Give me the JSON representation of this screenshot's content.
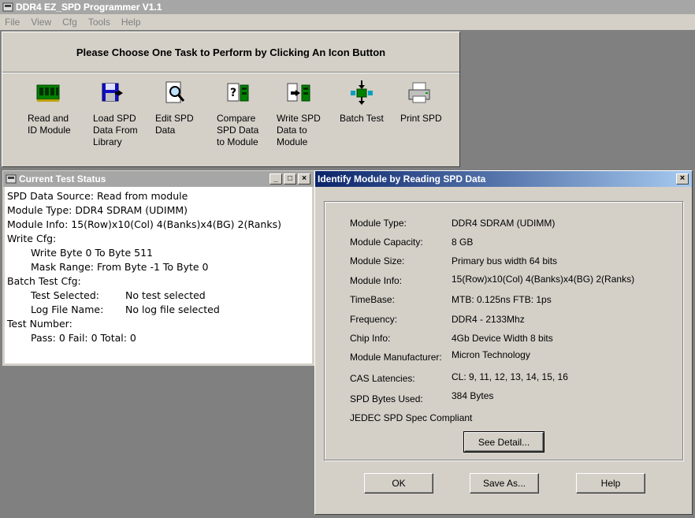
{
  "app": {
    "title": "DDR4 EZ_SPD Programmer V1.1"
  },
  "menu": [
    "File",
    "View",
    "Cfg",
    "Tools",
    "Help"
  ],
  "task_panel": {
    "heading": "Please Choose One Task to Perform by Clicking An Icon Button",
    "tasks": [
      {
        "icon": "memory-module-icon",
        "lines": [
          "Read and",
          "ID Module"
        ]
      },
      {
        "icon": "floppy-load-icon",
        "lines": [
          "Load SPD",
          "Data From",
          "Library"
        ]
      },
      {
        "icon": "magnifier-document-icon",
        "lines": [
          "Edit SPD",
          "Data"
        ]
      },
      {
        "icon": "compare-icon",
        "lines": [
          "Compare",
          "SPD Data",
          "to Module"
        ]
      },
      {
        "icon": "write-module-icon",
        "lines": [
          "Write SPD",
          "Data to",
          "Module"
        ]
      },
      {
        "icon": "batch-test-icon",
        "lines": [
          "Batch Test"
        ]
      },
      {
        "icon": "printer-icon",
        "lines": [
          "Print SPD"
        ]
      }
    ]
  },
  "status_window": {
    "title": "Current Test Status",
    "lines": {
      "source": "SPD Data Source:  Read from module",
      "type": "Module Type: DDR4 SDRAM (UDIMM)",
      "info": "Module Info:  15(Row)x10(Col) 4(Banks)x4(BG) 2(Ranks)",
      "write_cfg": "Write Cfg:",
      "write_bytes": "Write Byte 0 To Byte 511",
      "mask_range": "Mask Range: From Byte -1 To Byte 0",
      "batch_cfg": "Batch Test Cfg:",
      "test_selected_label": "Test Selected:",
      "test_selected_value": "No test selected",
      "log_label": "Log File Name:",
      "log_value": "No log file selected",
      "test_number": "Test Number:",
      "counts": "Pass: 0 Fail: 0 Total: 0"
    },
    "buttons": {
      "minimize": "_",
      "maximize": "□",
      "close": "×"
    }
  },
  "dialog": {
    "title": "Identify Module by Reading SPD Data",
    "close": "×",
    "rows": [
      {
        "label": "Module Type:",
        "value": "DDR4 SDRAM (UDIMM)"
      },
      {
        "label": "Module Capacity:",
        "value": "8 GB"
      },
      {
        "label": "Module Size:",
        "value": "Primary bus width 64 bits"
      },
      {
        "label": "Module Info:",
        "value": "15(Row)x10(Col) 4(Banks)x4(BG) 2(Ranks)"
      },
      {
        "label": "TimeBase:",
        "value": "MTB: 0.125ns FTB: 1ps"
      },
      {
        "label": "Frequency:",
        "value": "DDR4 - 2133Mhz"
      },
      {
        "label": "Chip Info:",
        "value": "4Gb Device Width 8 bits"
      },
      {
        "label": "Module Manufacturer:",
        "value": "Micron Technology"
      },
      {
        "label": "CAS Latencies:",
        "value": "CL: 9, 11, 12, 13, 14, 15, 16"
      },
      {
        "label": "SPD Bytes Used:",
        "value": "384 Bytes"
      }
    ],
    "compliance": "JEDEC SPD Spec Compliant",
    "see_detail": "See Detail...",
    "ok": "OK",
    "save_as": "Save As...",
    "help": "Help"
  }
}
